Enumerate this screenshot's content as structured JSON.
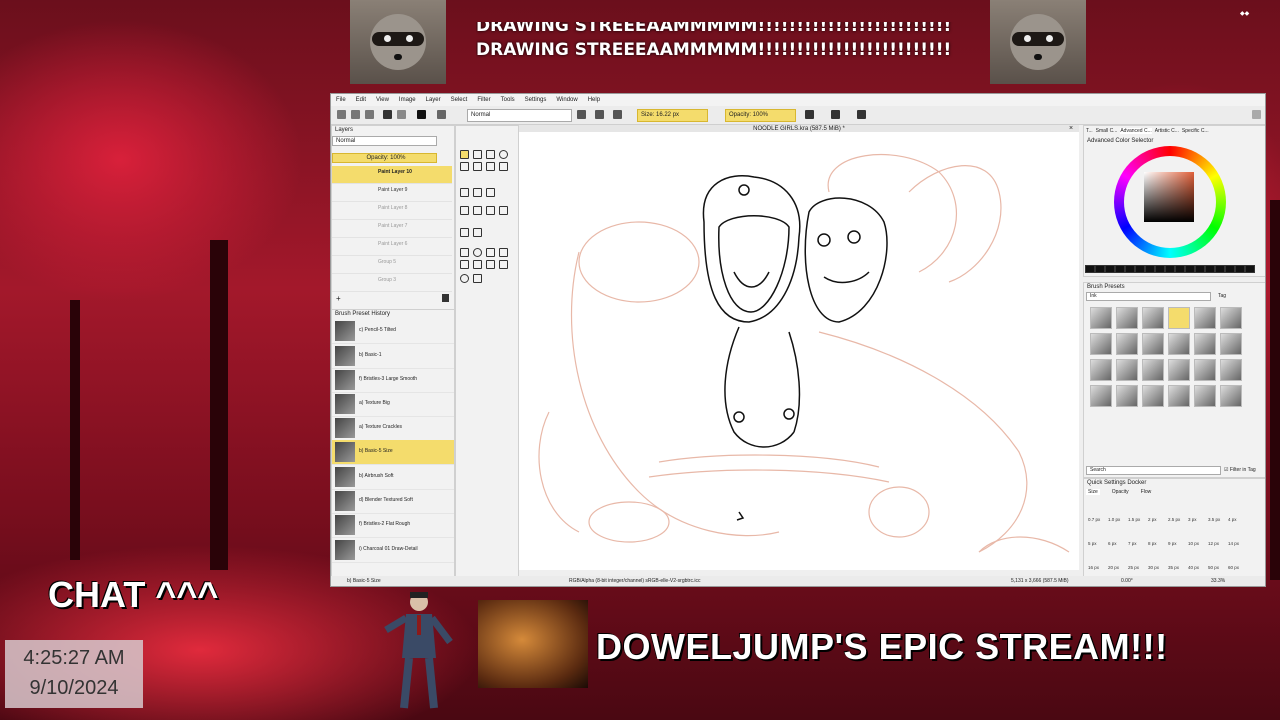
{
  "stream": {
    "ticker_lines": [
      "DRAWING STREEEAAMMMMM!!!!!!!!!!!!!!!!!!!!!!!!!",
      "DRAWING STREEEAAMMMMM!!!!!!!!!!!!!!!!!!!!!!!!!"
    ],
    "chat_label": "CHAT ^^^",
    "clock_time": "4:25:27 AM",
    "clock_date": "9/10/2024",
    "banner": "DOWELJUMP'S EPIC STREAM!!!"
  },
  "krita": {
    "menu": [
      "File",
      "Edit",
      "View",
      "Image",
      "Layer",
      "Select",
      "Filter",
      "Tools",
      "Settings",
      "Window",
      "Help"
    ],
    "blend_mode": "Normal",
    "size_label": "Size: 16.22 px",
    "opacity_label": "Opacity: 100%",
    "document_title": "NOODLE GIRLS.kra (587.5 MiB) *",
    "layers": {
      "title": "Layers",
      "blend": "Normal",
      "opacity": "Opacity: 100%",
      "items": [
        "Paint Layer 10",
        "Paint Layer 9",
        "Paint Layer 8",
        "Paint Layer 7",
        "Paint Layer 6",
        "Group 5",
        "Group 3"
      ]
    },
    "brush_history": {
      "title": "Brush Preset History",
      "items": [
        "c) Pencil-5 Tilted",
        "b) Basic-1",
        "f) Bristles-3 Large Smooth",
        "a) Texture Big",
        "a) Texture Crackles",
        "b) Basic-5 Size",
        "b) Airbrush Soft",
        "d) Blender Textured Soft",
        "f) Bristles-2 Flat Rough",
        "i) Charcoal 01 Draw-Detail"
      ],
      "selected_index": 5,
      "current": "b) Basic-5 Size"
    },
    "color_selector": {
      "tabs": [
        "T...",
        "Small C...",
        "Advanced C...",
        "Artistic C...",
        "Specific C..."
      ],
      "title": "Advanced Color Selector"
    },
    "brush_presets": {
      "title": "Brush Presets",
      "tag_filter": "Ink",
      "tag_label": "Tag",
      "search_placeholder": "Search",
      "filter_in_tag": "Filter in Tag"
    },
    "quick_settings": {
      "title": "Quick Settings Docker",
      "tabs": [
        "Size",
        "Opacity",
        "Flow"
      ],
      "row1": [
        "0.7 px",
        "1.0 px",
        "1.5 px",
        "2 px",
        "2.5 px",
        "3 px",
        "3.5 px",
        "4 px"
      ],
      "row2": [
        "5 px",
        "6 px",
        "7 px",
        "8 px",
        "9 px",
        "10 px",
        "12 px",
        "14 px"
      ],
      "row3": [
        "16 px",
        "20 px",
        "25 px",
        "30 px",
        "35 px",
        "40 px",
        "50 px",
        "60 px"
      ]
    },
    "status": {
      "current_brush": "b) Basic-5 Size",
      "color_space": "RGB/Alpha (8-bit integer/channel) sRGB-elle-V2-srgbtrc.icc",
      "dimensions": "5,131 x 3,666 (587.5 MiB)",
      "rotation": "0.00°",
      "zoom": "33.3%"
    }
  }
}
